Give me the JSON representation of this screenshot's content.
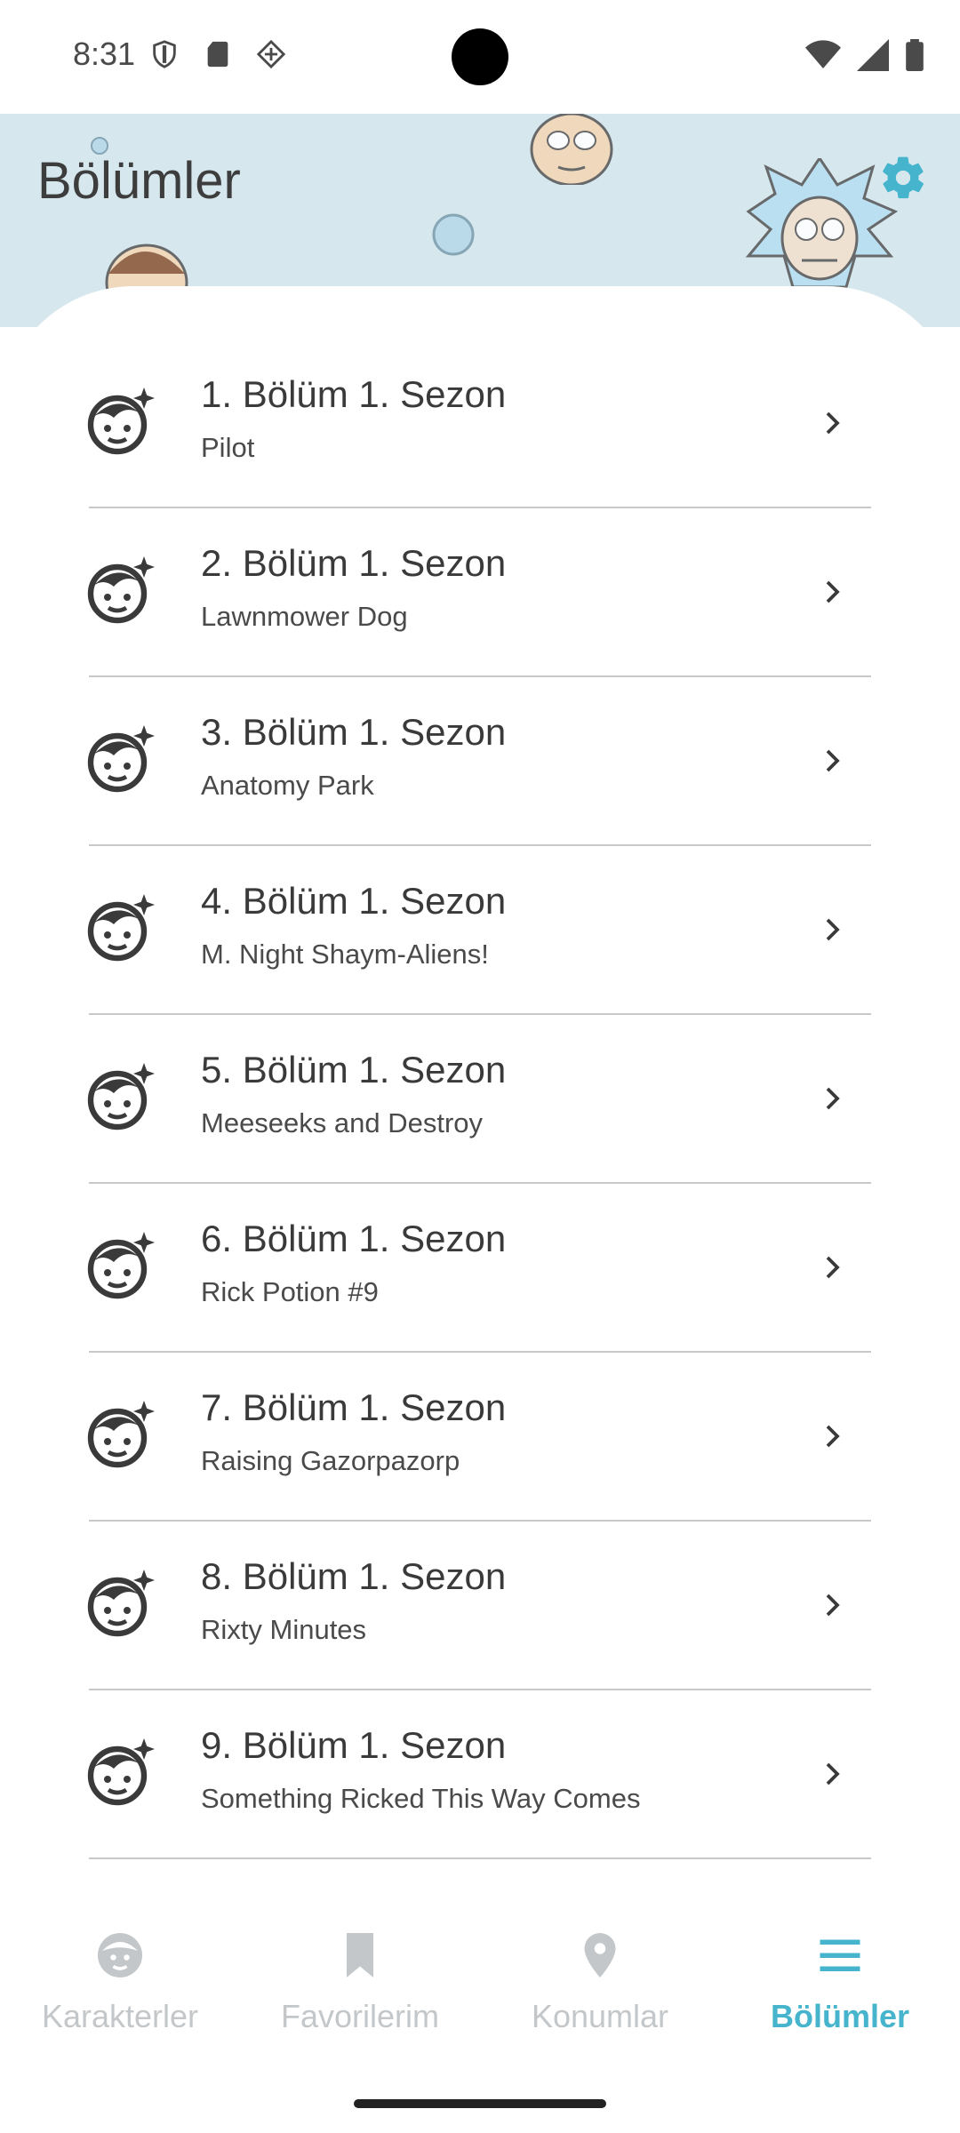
{
  "status_bar": {
    "time": "8:31"
  },
  "header": {
    "title": "Bölümler"
  },
  "episodes": [
    {
      "title": "1. Bölüm 1. Sezon",
      "name": "Pilot"
    },
    {
      "title": "2. Bölüm 1. Sezon",
      "name": "Lawnmower Dog"
    },
    {
      "title": "3. Bölüm 1. Sezon",
      "name": "Anatomy Park"
    },
    {
      "title": "4. Bölüm 1. Sezon",
      "name": "M. Night Shaym-Aliens!"
    },
    {
      "title": "5. Bölüm 1. Sezon",
      "name": "Meeseeks and Destroy"
    },
    {
      "title": "6. Bölüm 1. Sezon",
      "name": "Rick Potion #9"
    },
    {
      "title": "7. Bölüm 1. Sezon",
      "name": "Raising Gazorpazorp"
    },
    {
      "title": "8. Bölüm 1. Sezon",
      "name": "Rixty Minutes"
    },
    {
      "title": "9. Bölüm 1. Sezon",
      "name": "Something Ricked This Way Comes"
    }
  ],
  "bottom_nav": [
    {
      "label": "Karakterler",
      "icon": "character-face-icon",
      "active": false
    },
    {
      "label": "Favorilerim",
      "icon": "bookmark-icon",
      "active": false
    },
    {
      "label": "Konumlar",
      "icon": "location-pin-icon",
      "active": false
    },
    {
      "label": "Bölümler",
      "icon": "menu-lines-icon",
      "active": true
    }
  ],
  "colors": {
    "accent": "#45b4cc",
    "header_bg": "#d6e8ee",
    "inactive": "#c3c7c9"
  }
}
